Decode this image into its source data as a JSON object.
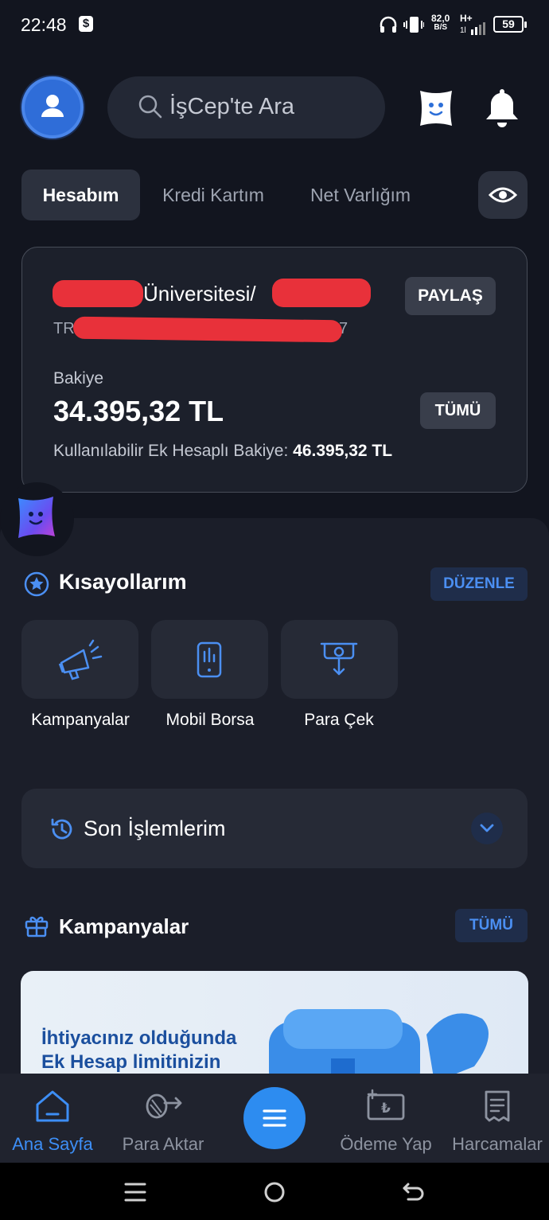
{
  "status_bar": {
    "time": "22:48",
    "speed_value": "82,0",
    "speed_unit": "B/S",
    "network": "H+",
    "battery": "59"
  },
  "header": {
    "search_placeholder": "İşCep'te Ara"
  },
  "tabs": [
    {
      "label": "Hesabım",
      "active": true
    },
    {
      "label": "Kredi Kartım",
      "active": false
    },
    {
      "label": "Net Varlığım",
      "active": false
    }
  ],
  "account": {
    "name_visible": "Üniversitesi/",
    "iban_prefix": "TR",
    "iban_suffix": "7",
    "share_label": "PAYLAŞ",
    "balance_label": "Bakiye",
    "balance_value": "34.395,32 TL",
    "all_label": "TÜMÜ",
    "available_label": "Kullanılabilir Ek Hesaplı Bakiye:",
    "available_value": "46.395,32 TL"
  },
  "shortcuts": {
    "title": "Kısayollarım",
    "edit_label": "DÜZENLE",
    "items": [
      {
        "label": "Kampanyalar",
        "icon": "megaphone-icon"
      },
      {
        "label": "Mobil Borsa",
        "icon": "stock-phone-icon"
      },
      {
        "label": "Para Çek",
        "icon": "atm-withdraw-icon"
      }
    ]
  },
  "recent": {
    "title": "Son İşlemlerim"
  },
  "campaigns": {
    "title": "Kampanyalar",
    "all_label": "TÜMÜ",
    "banner_line1": "İhtiyacınız olduğunda",
    "banner_line2": "Ek Hesap limitinizin"
  },
  "bottom_nav": {
    "items": [
      {
        "label": "Ana Sayfa",
        "active": true
      },
      {
        "label": "Para Aktar",
        "active": false
      },
      {
        "label": "Ödeme Yap",
        "active": false
      },
      {
        "label": "Harcamalar",
        "active": false
      }
    ]
  },
  "colors": {
    "background": "#12151f",
    "accent": "#2d8cf0",
    "accent_text": "#4b8ff2",
    "redaction": "#e8313a"
  }
}
